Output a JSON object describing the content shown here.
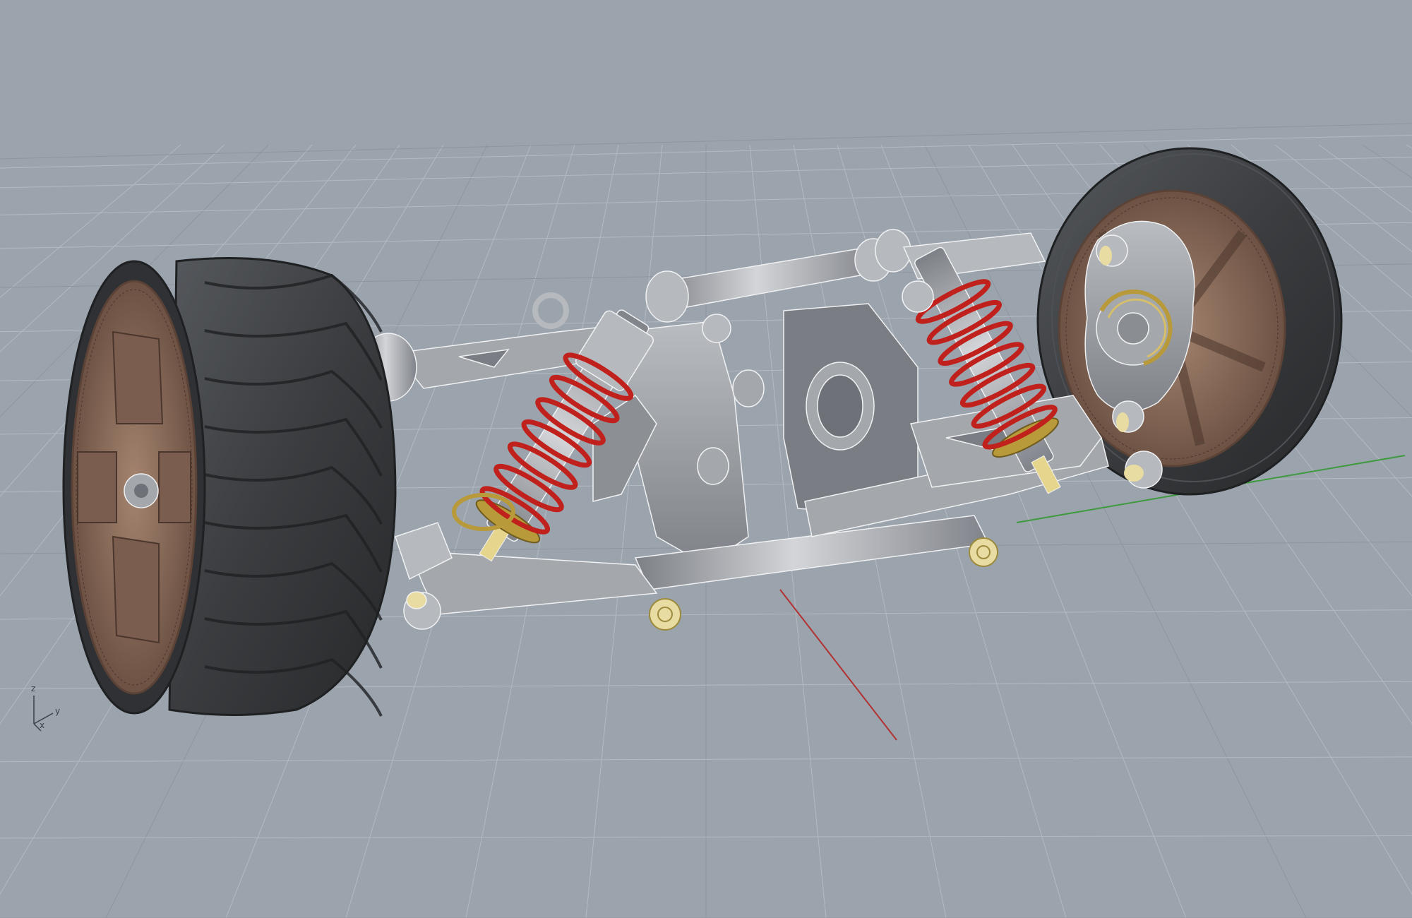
{
  "viewport": {
    "background": "#9ba3ad",
    "grid_color": "#b4bac2",
    "grid_major_color": "#8e959f",
    "x_axis_color": "#b23232",
    "y_axis_color": "#3f9a3f",
    "display_mode": "technical-shaded"
  },
  "model": {
    "tire_color": "#3a3c3f",
    "rim_color": "#8a6b5a",
    "frame_color": "#8c8f94",
    "spring_color": "#c0211c",
    "shock_body_color": "#a9acb1",
    "fastener_color": "#e9dca2",
    "brass_color": "#b89a3a"
  },
  "axis_widget": {
    "z_label": "z",
    "y_label": "y",
    "x_label": "x"
  }
}
